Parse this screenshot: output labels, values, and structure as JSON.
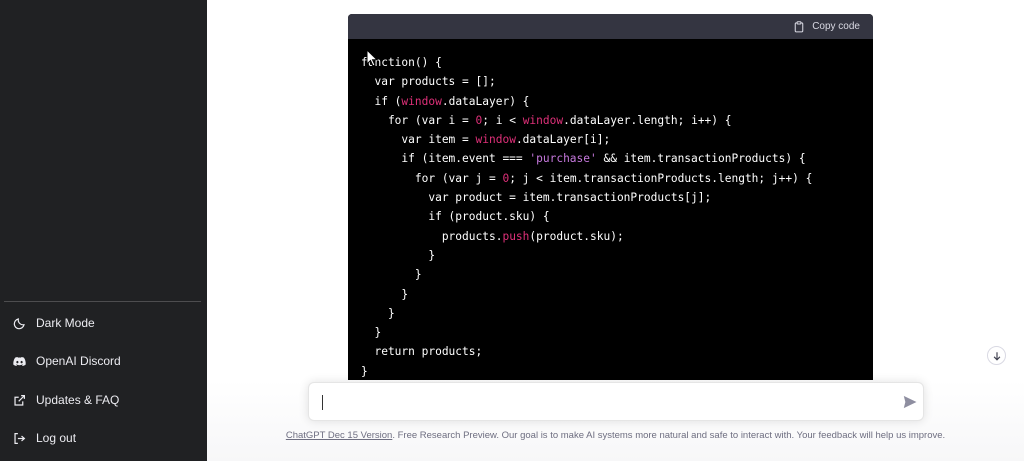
{
  "sidebar": {
    "items": [
      {
        "label": "Dark Mode",
        "icon": "moon-icon"
      },
      {
        "label": "OpenAI Discord",
        "icon": "discord-icon"
      },
      {
        "label": "Updates & FAQ",
        "icon": "external-link-icon"
      },
      {
        "label": "Log out",
        "icon": "logout-icon"
      }
    ]
  },
  "code_block": {
    "copy_label": "Copy code",
    "lines": [
      "function() {",
      "  var products = [];",
      "  if (window.dataLayer) {",
      "    for (var i = 0; i < window.dataLayer.length; i++) {",
      "      var item = window.dataLayer[i];",
      "      if (item.event === 'purchase' && item.transactionProducts) {",
      "        for (var j = 0; j < item.transactionProducts.length; j++) {",
      "          var product = item.transactionProducts[j];",
      "          if (product.sku) {",
      "            products.push(product.sku);",
      "          }",
      "        }",
      "      }",
      "    }",
      "  }",
      "  return products;",
      "}"
    ]
  },
  "composer": {
    "value": "",
    "placeholder": ""
  },
  "footer": {
    "version_link": "ChatGPT Dec 15 Version",
    "text": ". Free Research Preview. Our goal is to make AI systems more natural and safe to interact with. Your feedback will help us improve."
  },
  "colors": {
    "sidebar_bg": "#202123",
    "code_bg": "#000000",
    "code_header_bg": "#343541",
    "keyword_accent": "#df3079",
    "string_accent": "#c678dd"
  }
}
